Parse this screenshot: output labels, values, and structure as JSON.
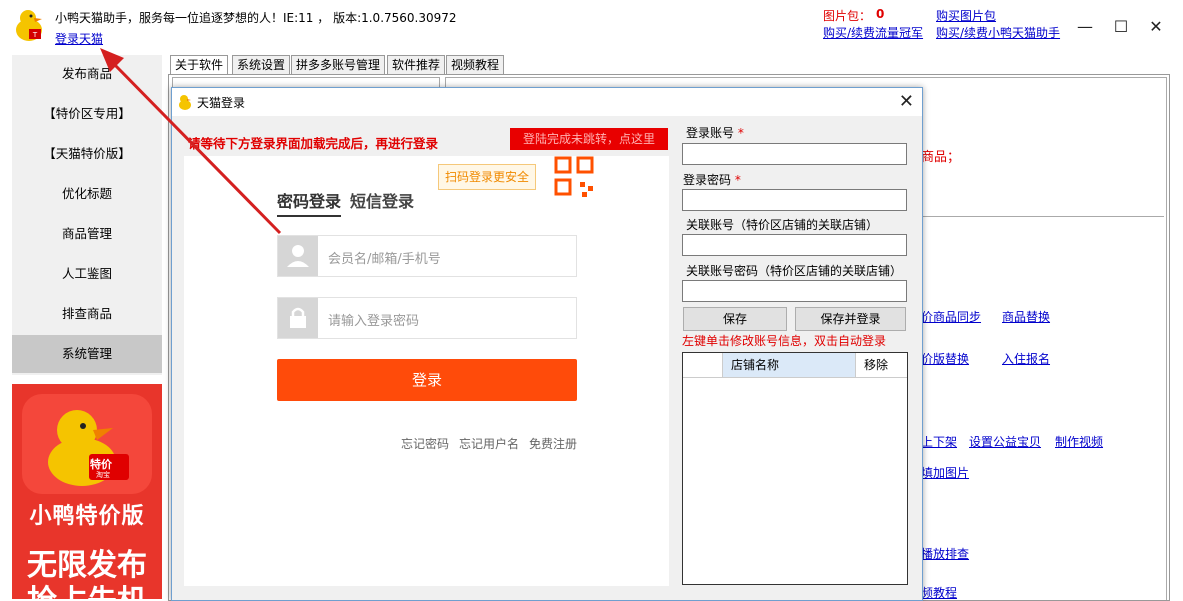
{
  "header": {
    "title": "小鸭天猫助手，服务每一位追逐梦想的人！IE:11 ， 版本:1.0.7560.30972",
    "login_link": "登录天猫",
    "pic_label": "图片包：",
    "pic_count": "0",
    "buy_pic": "购买图片包",
    "buy_flow": "购买/续费流量冠军",
    "buy_duck": "购买/续费小鸭天猫助手"
  },
  "window_controls": {
    "minimize": "—",
    "maximize": "☐",
    "close": "✕"
  },
  "sidebar": {
    "items": [
      {
        "label": "发布商品"
      },
      {
        "label": "【特价区专用】"
      },
      {
        "label": "【天猫特价版】"
      },
      {
        "label": "优化标题"
      },
      {
        "label": "商品管理"
      },
      {
        "label": "人工鉴图"
      },
      {
        "label": "排查商品"
      },
      {
        "label": "系统管理"
      }
    ],
    "active_index": 7
  },
  "promo": {
    "badge_text": "特价",
    "badge_sub": "淘宝",
    "line1": "小鸭特价版",
    "line2": "无限发布",
    "line3": "抢占先机"
  },
  "tabs": [
    {
      "label": "关于软件"
    },
    {
      "label": "系统设置"
    },
    {
      "label": "拼多多账号管理"
    },
    {
      "label": "软件推荐"
    },
    {
      "label": "视频教程"
    }
  ],
  "background": {
    "red_text": "商品；",
    "links": [
      "价商品同步",
      "商品替换",
      "价版替换",
      "入住报名",
      "上下架",
      "设置公益宝贝",
      "制作视频",
      "填加图片",
      "播放排查",
      "频教程"
    ]
  },
  "dialog": {
    "title": "天猫登录",
    "close": "✕",
    "hint": "请等待下方登录界面加载完成后，再进行登录",
    "red_button": "登陆完成未跳转，点这里",
    "login": {
      "qr_tip": "扫码登录更安全",
      "tab_password": "密码登录",
      "tab_sms": "短信登录",
      "username_placeholder": "会员名/邮箱/手机号",
      "password_placeholder": "请输入登录密码",
      "submit": "登录",
      "forgot_password": "忘记密码",
      "forgot_username": "忘记用户名",
      "register": "免费注册"
    },
    "form": {
      "account_label": "登录账号",
      "password_label": "登录密码",
      "required_mark": "*",
      "linked_account_label": "关联账号（特价区店铺的关联店铺）",
      "linked_password_label": "关联账号密码（特价区店铺的关联店铺）",
      "save": "保存",
      "save_login": "保存并登录",
      "help_text": "左键单击修改账号信息，双击自动登录",
      "grid_headers": [
        "",
        "店铺名称",
        "移除"
      ]
    }
  }
}
